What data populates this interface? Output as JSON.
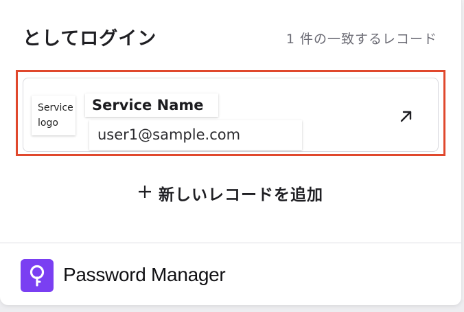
{
  "header": {
    "title": "としてログイン",
    "match_count": "1 件の一致するレコード"
  },
  "record": {
    "logo_placeholder": "Service logo",
    "service_name": "Service Name",
    "username": "user1@sample.com",
    "open_icon": "arrow-up-right-icon"
  },
  "add_record": {
    "icon": "plus-icon",
    "label": "新しいレコードを追加"
  },
  "footer": {
    "app_icon": "keyhole-icon",
    "app_name": "Password Manager"
  },
  "colors": {
    "highlight": "#e0482d",
    "brand": "#7a3ff2"
  }
}
